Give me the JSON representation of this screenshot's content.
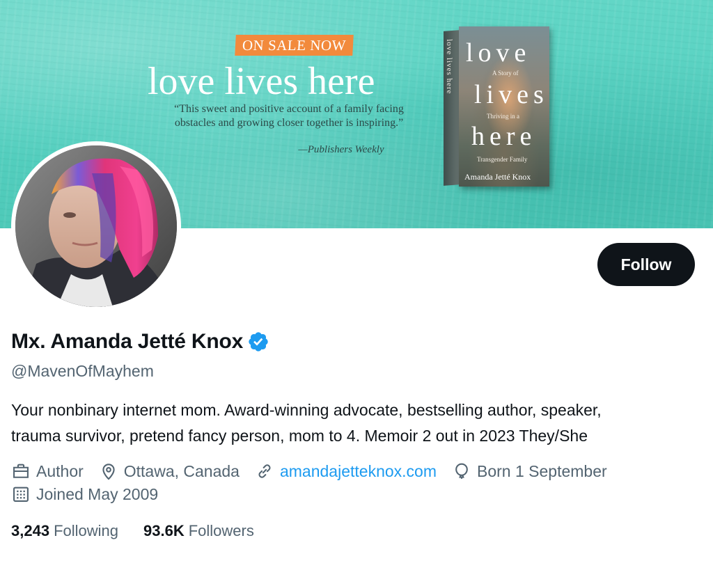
{
  "banner": {
    "sale_badge": "ON SALE NOW",
    "title": "love lives here",
    "quote": "“This sweet and positive account of a family facing obstacles and growing closer together is inspiring.”",
    "attribution": "—Publishers Weekly",
    "book": {
      "spine_text": "love lives here",
      "title_words": [
        "love",
        "lives",
        "here"
      ],
      "subtitle_1": "A Story of",
      "subtitle_2": "Thriving in a",
      "subtitle_3": "Transgender Family",
      "author": "Amanda Jetté Knox"
    },
    "colors": {
      "background": "#58d2c2",
      "badge": "#f28a3c"
    }
  },
  "profile": {
    "display_name": "Mx. Amanda Jetté Knox",
    "verified": true,
    "handle": "@MavenOfMayhem",
    "bio_line_1": "Your nonbinary internet mom. Award-winning advocate, bestselling author, speaker,",
    "bio_line_2": "trauma survivor, pretend fancy person, mom to 4. Memoir 2 out in 2023 They/She",
    "meta": {
      "category": {
        "icon": "briefcase-icon",
        "label": "Author"
      },
      "location": {
        "icon": "location-pin-icon",
        "label": "Ottawa, Canada"
      },
      "website": {
        "icon": "link-icon",
        "label": "amandajetteknox.com"
      },
      "birthday": {
        "icon": "balloon-icon",
        "label": "Born 1 September"
      },
      "joined": {
        "icon": "calendar-icon",
        "label": "Joined May 2009"
      }
    },
    "stats": {
      "following_count": "3,243",
      "following_label": "Following",
      "followers_count": "93.6K",
      "followers_label": "Followers"
    }
  },
  "actions": {
    "follow_label": "Follow"
  },
  "colors": {
    "text_primary": "#0f1419",
    "text_secondary": "#536471",
    "link": "#1d9bf0",
    "verified": "#1d9bf0",
    "button_bg": "#0f1419"
  }
}
